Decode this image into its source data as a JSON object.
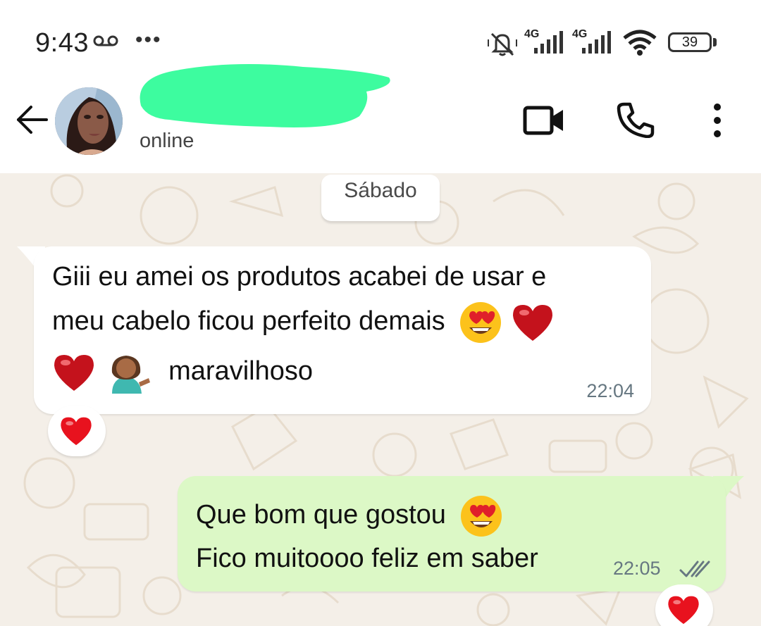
{
  "status_bar": {
    "time": "9:43",
    "network_1": "4G",
    "network_2": "4G",
    "battery": "39"
  },
  "header": {
    "contact_status": "online"
  },
  "chat": {
    "date_chip": "Sábado",
    "messages": [
      {
        "direction": "incoming",
        "lines": [
          "Giii eu amei os produtos acabei de usar e",
          "meu cabelo ficou perfeito demais",
          "maravilhoso"
        ],
        "time": "22:04",
        "reaction": "heart"
      },
      {
        "direction": "outgoing",
        "lines": [
          "Que bom que gostou",
          "Fico muitoooo feliz em saber"
        ],
        "time": "22:05",
        "status": "read",
        "reaction": "heart"
      }
    ]
  },
  "colors": {
    "outgoing_bubble": "#dcf8c6",
    "incoming_bubble": "#ffffff",
    "chat_background": "#f4efe8",
    "read_ticks": "#667781",
    "redaction": "#3dfc9f"
  },
  "icons": [
    "back-arrow-icon",
    "video-call-icon",
    "phone-icon",
    "more-vert-icon",
    "voicemail-icon",
    "mute-icon",
    "signal-icon",
    "wifi-icon",
    "battery-icon",
    "heart-eyes-emoji",
    "red-heart-emoji",
    "person-tipping-hand-emoji",
    "double-check-icon"
  ]
}
